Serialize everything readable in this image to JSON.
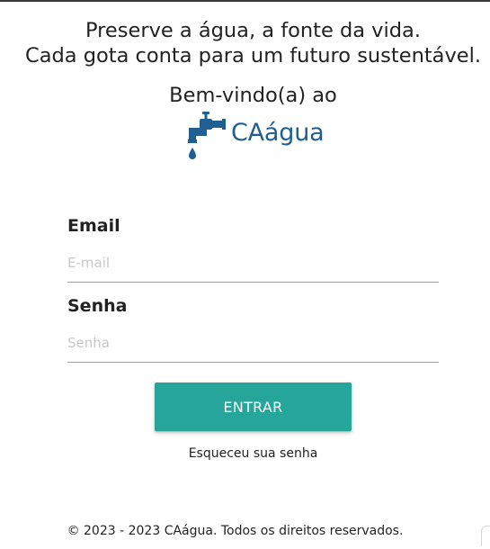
{
  "header": {
    "tagline_line1": "Preserve a água, a fonte da vida.",
    "tagline_line2": "Cada gota conta para um futuro sustentável.",
    "welcome": "Bem-vindo(a) ao"
  },
  "logo": {
    "icon": "faucet-icon",
    "name": "CAágua",
    "color": "#1f5f91"
  },
  "form": {
    "email_label": "Email",
    "email_placeholder": "E-mail",
    "email_value": "",
    "password_label": "Senha",
    "password_placeholder": "Senha",
    "password_value": ""
  },
  "actions": {
    "submit_label": "ENTRAR",
    "submit_color": "#26a69a",
    "forgot_label": "Esqueceu sua senha"
  },
  "footer": {
    "text": "© 2023 - 2023 CAágua. Todos os direitos reservados."
  }
}
